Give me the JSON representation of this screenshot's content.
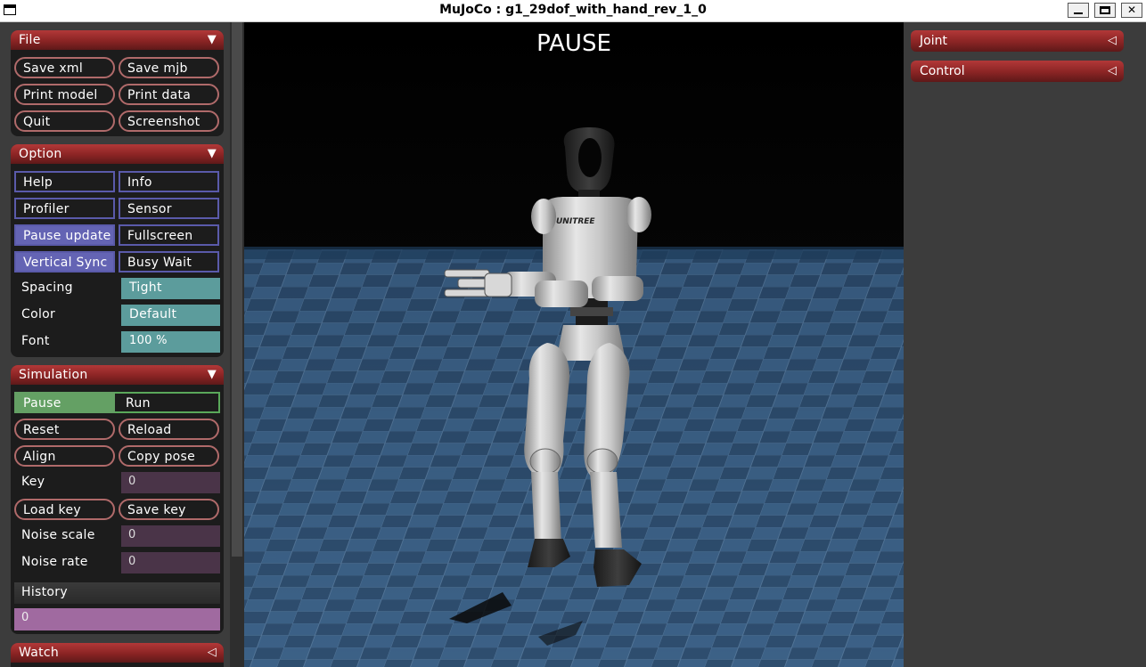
{
  "window": {
    "title": "MuJoCo : g1_29dof_with_hand_rev_1_0"
  },
  "file": {
    "header": "File",
    "arrow": "▼",
    "buttons": [
      "Save xml",
      "Save mjb",
      "Print model",
      "Print data",
      "Quit",
      "Screenshot"
    ]
  },
  "option": {
    "header": "Option",
    "arrow": "▼",
    "checks": [
      {
        "label": "Help",
        "on": false
      },
      {
        "label": "Info",
        "on": false
      },
      {
        "label": "Profiler",
        "on": false
      },
      {
        "label": "Sensor",
        "on": false
      },
      {
        "label": "Pause update",
        "on": true
      },
      {
        "label": "Fullscreen",
        "on": false
      },
      {
        "label": "Vertical Sync",
        "on": true
      },
      {
        "label": "Busy Wait",
        "on": false
      }
    ],
    "spacing": {
      "label": "Spacing",
      "value": "Tight"
    },
    "color": {
      "label": "Color",
      "value": "Default"
    },
    "font": {
      "label": "Font",
      "value": "100 %"
    }
  },
  "simulation": {
    "header": "Simulation",
    "arrow": "▼",
    "pause": "Pause",
    "run": "Run",
    "reset": "Reset",
    "reload": "Reload",
    "align": "Align",
    "copy_pose": "Copy pose",
    "key": {
      "label": "Key",
      "value": "0"
    },
    "load_key": "Load key",
    "save_key": "Save key",
    "noise_scale": {
      "label": "Noise scale",
      "value": "0"
    },
    "noise_rate": {
      "label": "Noise rate",
      "value": "0"
    },
    "history": {
      "label": "History",
      "value": "0"
    }
  },
  "watch": {
    "header": "Watch",
    "arrow": "◁"
  },
  "viewport": {
    "status": "PAUSE",
    "robot_logo": "UNITREE"
  },
  "right": {
    "joint": {
      "header": "Joint",
      "arrow": "◁"
    },
    "control": {
      "header": "Control",
      "arrow": "◁"
    }
  },
  "colors": {
    "header_red": "#8a2424",
    "checkbox_on": "#6464b4",
    "select_teal": "#5c9c9c",
    "radio_on_green": "#64a064",
    "slider_purple": "#a06aa0",
    "panel_bg": "#3c3c3c"
  }
}
